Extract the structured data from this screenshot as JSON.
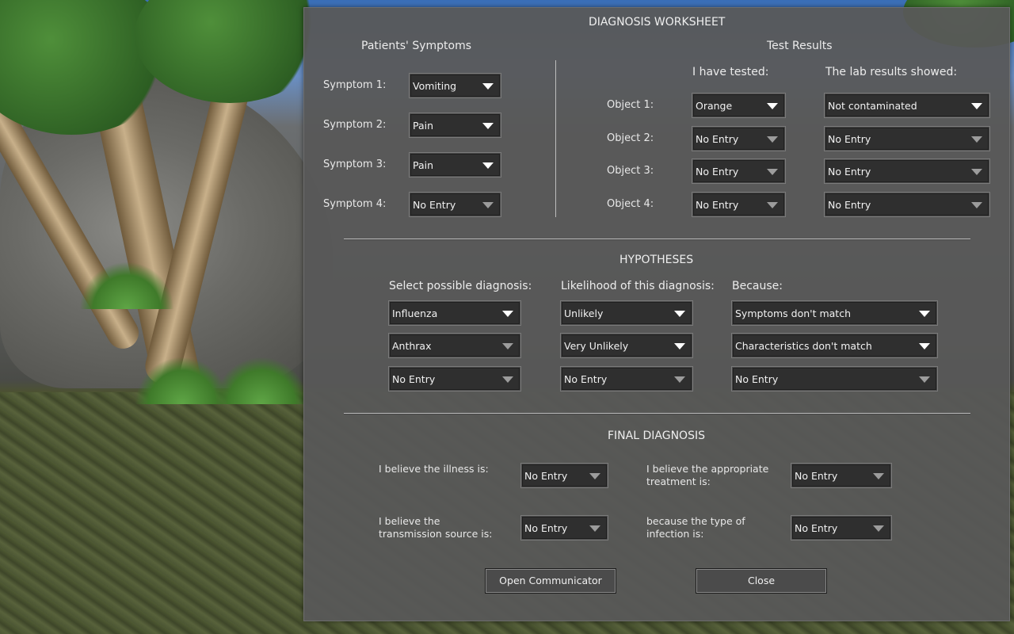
{
  "title": "DIAGNOSIS WORKSHEET",
  "symptoms": {
    "heading": "Patients' Symptoms",
    "rows": [
      {
        "label": "Symptom 1:",
        "value": "Vomiting"
      },
      {
        "label": "Symptom 2:",
        "value": "Pain"
      },
      {
        "label": "Symptom 3:",
        "value": "Pain"
      },
      {
        "label": "Symptom 4:",
        "value": "No Entry"
      }
    ]
  },
  "tests": {
    "heading": "Test Results",
    "col_tested": "I have tested:",
    "col_lab": "The lab results showed:",
    "rows": [
      {
        "label": "Object 1:",
        "tested": "Orange",
        "lab": "Not contaminated"
      },
      {
        "label": "Object 2:",
        "tested": "No Entry",
        "lab": "No Entry"
      },
      {
        "label": "Object 3:",
        "tested": "No Entry",
        "lab": "No Entry"
      },
      {
        "label": "Object 4:",
        "tested": "No Entry",
        "lab": "No Entry"
      }
    ]
  },
  "hypotheses": {
    "heading": "HYPOTHESES",
    "col_diagnosis": "Select possible diagnosis:",
    "col_likelihood": "Likelihood of this diagnosis:",
    "col_because": "Because:",
    "rows": [
      {
        "diagnosis": "Influenza",
        "likelihood": "Unlikely",
        "because": "Symptoms don't match"
      },
      {
        "diagnosis": "Anthrax",
        "likelihood": "Very Unlikely",
        "because": "Characteristics don't match"
      },
      {
        "diagnosis": "No Entry",
        "likelihood": "No Entry",
        "because": "No Entry"
      }
    ]
  },
  "final": {
    "heading": "FINAL DIAGNOSIS",
    "illness_label": "I believe the illness is:",
    "illness_value": "No Entry",
    "treatment_label_1": "I believe the appropriate",
    "treatment_label_2": "treatment is:",
    "treatment_value": "No Entry",
    "source_label_1": "I believe the",
    "source_label_2": "transmission source is:",
    "source_value": "No Entry",
    "infection_label_1": "because the type of",
    "infection_label_2": "infection is:",
    "infection_value": "No Entry"
  },
  "buttons": {
    "communicator": "Open Communicator",
    "close": "Close"
  }
}
